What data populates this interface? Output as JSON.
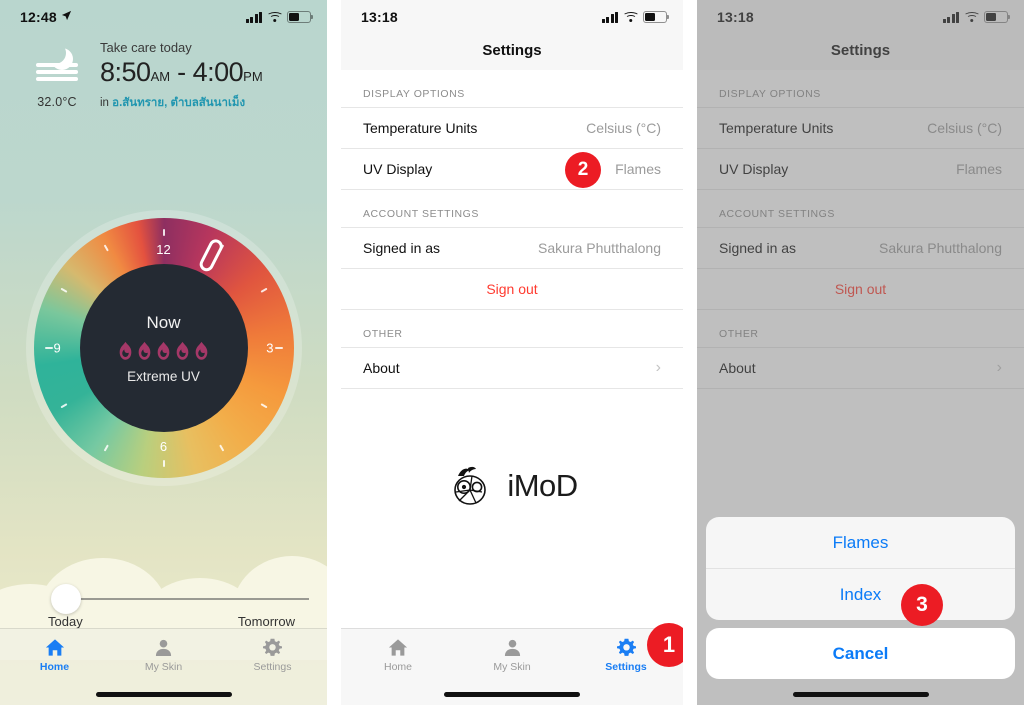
{
  "panel1": {
    "status": {
      "time": "12:48",
      "location_arrow": "location-arrow",
      "battery_pct": 52
    },
    "weather": {
      "note": "Take care today",
      "start_time": "8:50",
      "start_meridiem": "AM",
      "dash": "-",
      "end_time": "4:00",
      "end_meridiem": "PM",
      "temperature": "32.0°C",
      "location_prefix": "in",
      "location": "อ.สันทราย, ตำบลสันนาเม็ง"
    },
    "dial": {
      "center_top": "Now",
      "center_label": "Extreme UV",
      "flame_count": 5,
      "flame_color": "#a53868",
      "core_color": "#242a33",
      "hour_labels": [
        "12",
        "3",
        "6",
        "9"
      ],
      "pointer_angle_deg": 27
    },
    "slider": {
      "left_label": "Today",
      "right_label": "Tomorrow",
      "value_pct": 4
    },
    "tabs": [
      {
        "label": "Home",
        "icon": "home-icon",
        "active": true
      },
      {
        "label": "My Skin",
        "icon": "person-icon",
        "active": false
      },
      {
        "label": "Settings",
        "icon": "gear-icon",
        "active": false
      }
    ]
  },
  "panel2": {
    "status": {
      "time": "13:18",
      "battery_pct": 52
    },
    "nav_title": "Settings",
    "sections": [
      {
        "header": "DISPLAY OPTIONS",
        "rows": [
          {
            "label": "Temperature Units",
            "value": "Celsius (°C)",
            "type": "value"
          },
          {
            "label": "UV Display",
            "value": "Flames",
            "type": "value"
          }
        ]
      },
      {
        "header": "ACCOUNT SETTINGS",
        "rows": [
          {
            "label": "Signed in as",
            "value": "Sakura Phutthalong",
            "type": "value"
          },
          {
            "label": "Sign out",
            "value": "",
            "type": "destructive"
          }
        ]
      },
      {
        "header": "OTHER",
        "rows": [
          {
            "label": "About",
            "value": "›",
            "type": "disclosure"
          }
        ]
      }
    ],
    "brand": {
      "name": "iMoD",
      "mark": "imod-mascot-logo"
    },
    "tabs": [
      {
        "label": "Home",
        "icon": "home-icon",
        "active": false
      },
      {
        "label": "My Skin",
        "icon": "person-icon",
        "active": false
      },
      {
        "label": "Settings",
        "icon": "gear-icon",
        "active": true
      }
    ],
    "badge": "1"
  },
  "panel2_badge_uv": "2",
  "panel3": {
    "status": {
      "time": "13:18",
      "battery_pct": 52
    },
    "nav_title": "Settings",
    "sections": [
      {
        "header": "DISPLAY OPTIONS",
        "rows": [
          {
            "label": "Temperature Units",
            "value": "Celsius (°C)"
          },
          {
            "label": "UV Display",
            "value": "Flames"
          }
        ]
      },
      {
        "header": "ACCOUNT SETTINGS",
        "rows": [
          {
            "label": "Signed in as",
            "value": "Sakura Phutthalong"
          },
          {
            "label": "Sign out",
            "value": ""
          }
        ]
      },
      {
        "header": "OTHER",
        "rows": [
          {
            "label": "About",
            "value": "›"
          }
        ]
      }
    ],
    "action_sheet": {
      "options": [
        "Flames",
        "Index"
      ],
      "cancel": "Cancel"
    },
    "badge": "3"
  },
  "colors": {
    "accent_blue": "#0b7bf7",
    "tab_blue": "#1a7ef4",
    "badge_red": "#ec1c24",
    "destructive_red": "#ff3b30",
    "thai_teal": "#2196b0",
    "flame_magenta": "#a53868",
    "dial_core": "#242a33"
  }
}
